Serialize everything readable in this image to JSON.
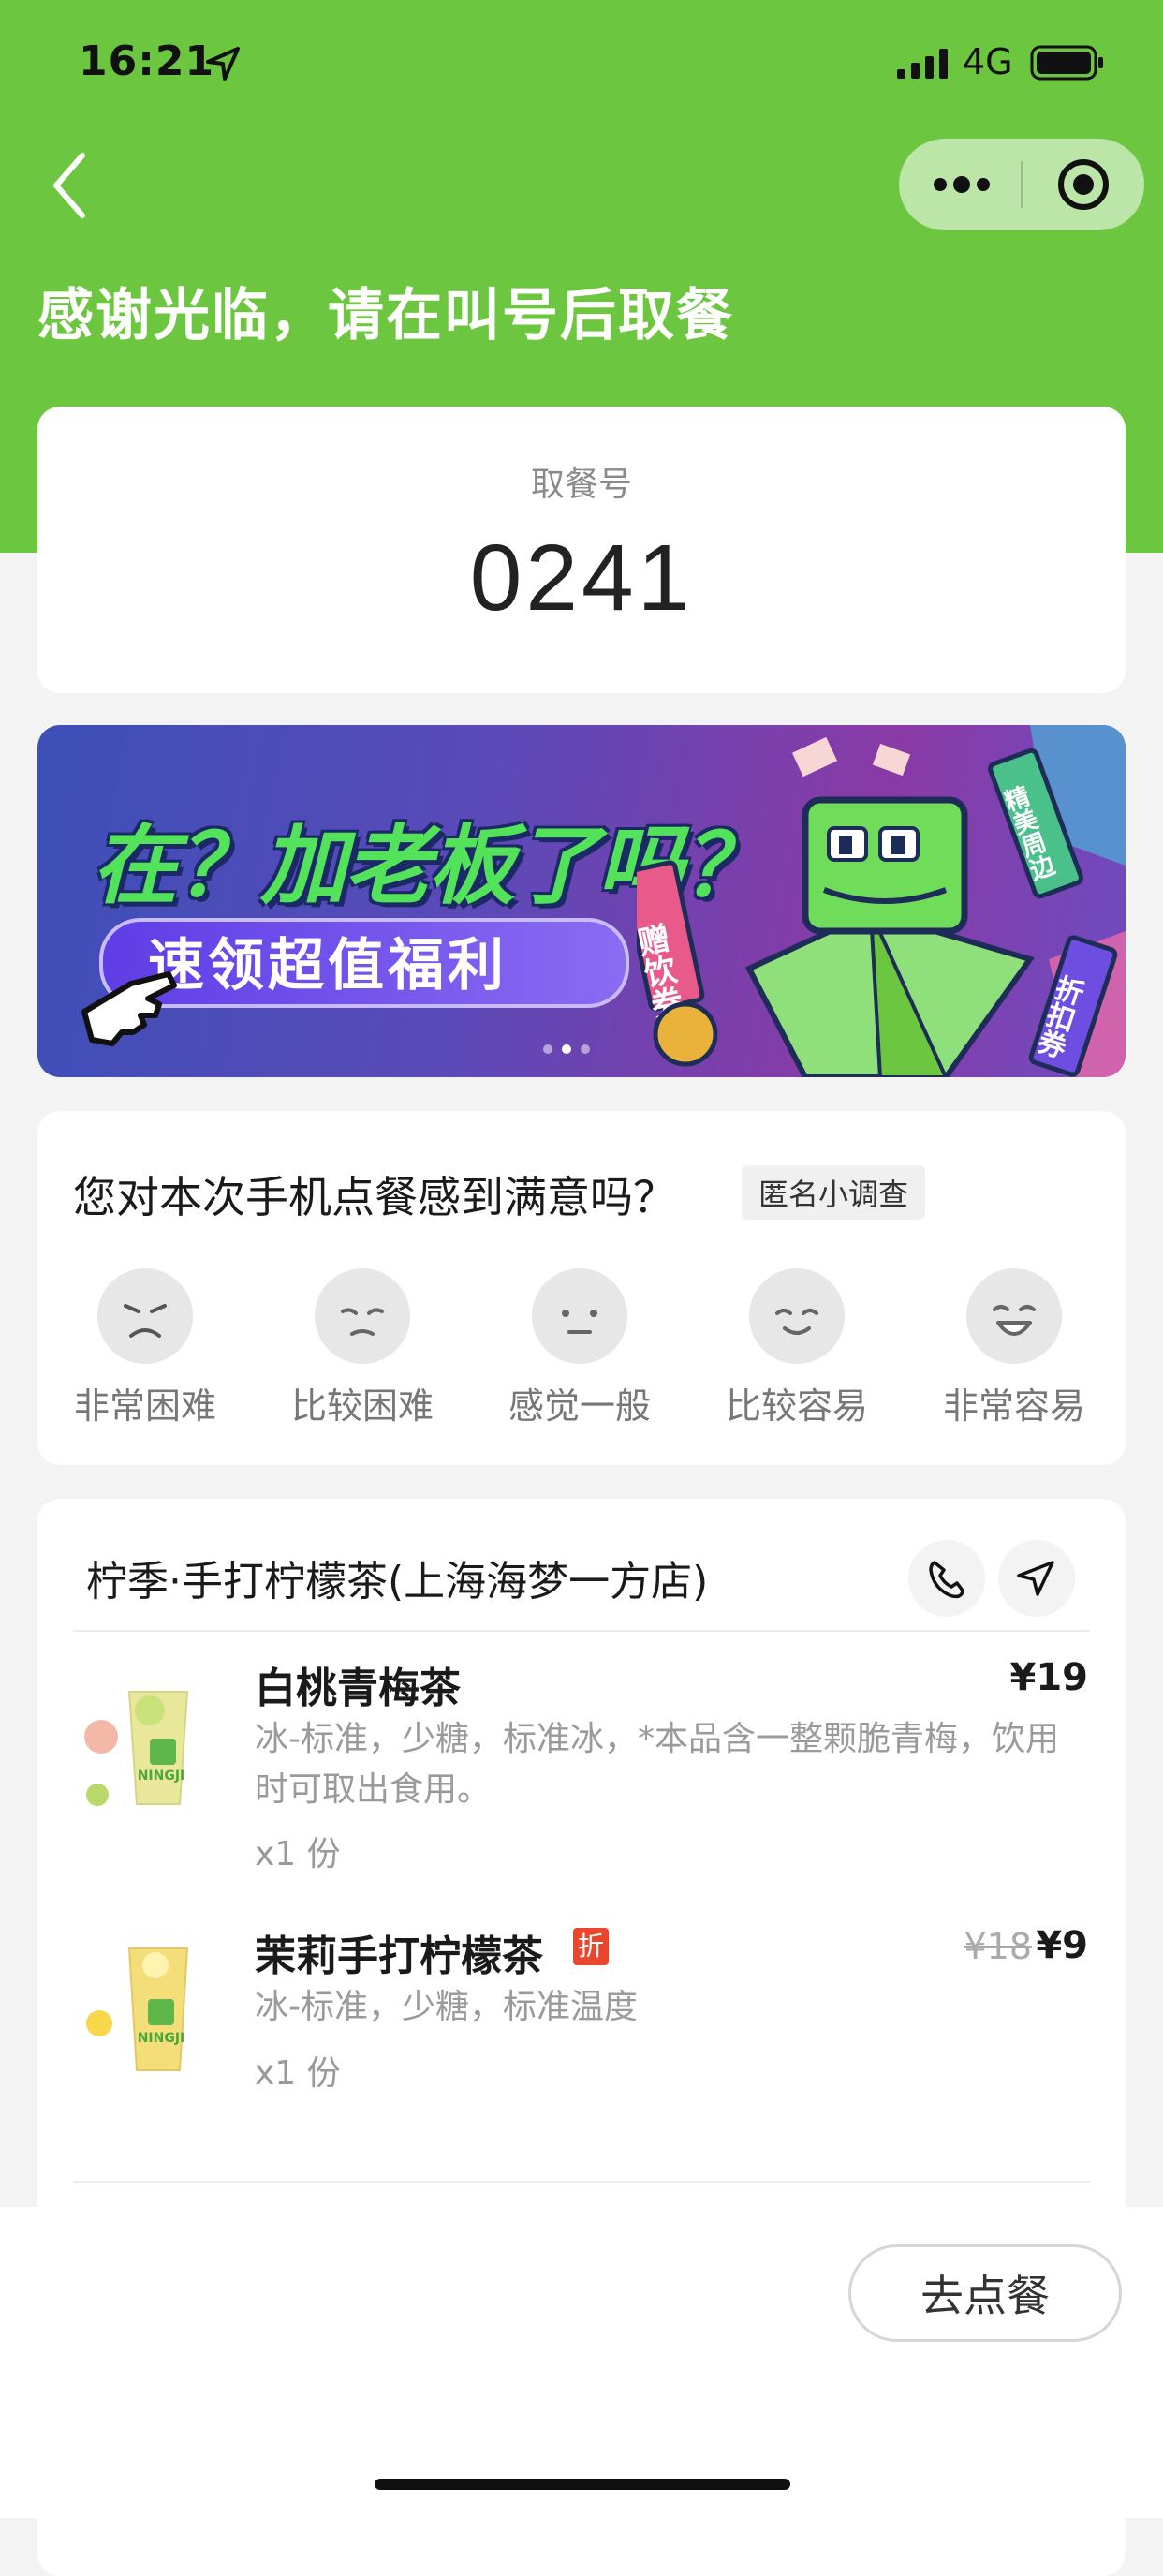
{
  "status_bar": {
    "time": "16:21",
    "network": "4G"
  },
  "nav": {
    "headline": "感谢光临，请在叫号后取餐"
  },
  "pickup": {
    "label": "取餐号",
    "number": "0241"
  },
  "banner": {
    "title": "在？加老板了吗？",
    "button_label": "速领超值福利",
    "ticket_1": "赠饮券",
    "ticket_2": "折扣券",
    "ticket_3": "精美周边",
    "page_count": 3,
    "active_page": 2
  },
  "survey": {
    "question": "您对本次手机点餐感到满意吗？",
    "tag": "匿名小调查",
    "options": [
      {
        "label": "非常困难",
        "icon": "very-hard-face-icon"
      },
      {
        "label": "比较困难",
        "icon": "hard-face-icon"
      },
      {
        "label": "感觉一般",
        "icon": "neutral-face-icon"
      },
      {
        "label": "比较容易",
        "icon": "easy-face-icon"
      },
      {
        "label": "非常容易",
        "icon": "very-easy-face-icon"
      }
    ]
  },
  "order": {
    "store_name": "柠季·手打柠檬茶(上海海梦一方店)",
    "items": [
      {
        "name": "白桃青梅茶",
        "desc": "冰-标准，少糖，标准冰，*本品含一整颗脆青梅，饮用时可取出食用。",
        "qty": "x1 份",
        "price": "¥19"
      },
      {
        "name": "茉莉手打柠檬茶",
        "badge": "折",
        "desc": "冰-标准，少糖，标准温度",
        "qty": "x1 份",
        "old_price": "¥18",
        "price": "¥9"
      }
    ]
  },
  "bottom": {
    "order_button": "去点餐"
  },
  "colors": {
    "brand_green": "#6cc63f",
    "discount_red": "#e8472e"
  }
}
